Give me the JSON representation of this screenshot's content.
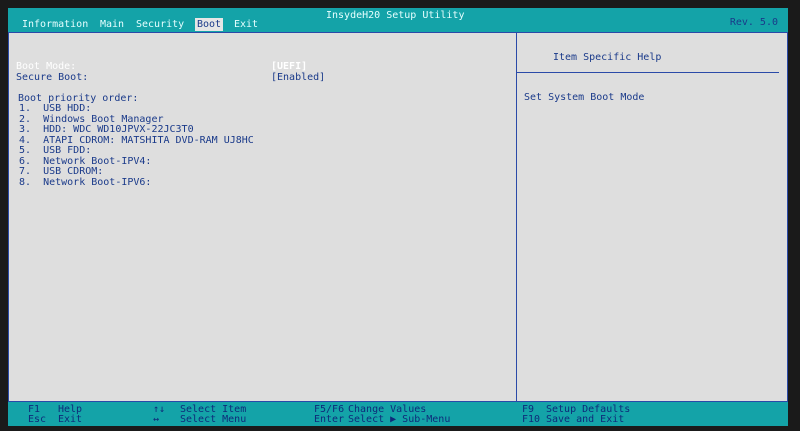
{
  "app_title": "InsydeH20 Setup Utility",
  "revision": "Rev. 5.0",
  "menu": [
    "Information",
    "Main",
    "Security",
    "Boot",
    "Exit"
  ],
  "boot_mode": {
    "label": "Boot Mode:",
    "value": "[UEFI]"
  },
  "secure_boot": {
    "label": "Secure Boot:",
    "value": "[Enabled]"
  },
  "boot_priority": {
    "heading": "Boot priority order:",
    "items": [
      "1.  USB HDD:",
      "2.  Windows Boot Manager",
      "3.  HDD: WDC WD10JPVX-22JC3T0",
      "4.  ATAPI CDROM: MATSHITA DVD-RAM UJ8HC",
      "5.  USB FDD:",
      "6.  Network Boot-IPV4:",
      "7.  USB CDROM:",
      "8.  Network Boot-IPV6:"
    ]
  },
  "help": {
    "title": "Item Specific Help",
    "text": "Set System Boot Mode"
  },
  "footer": {
    "f1_key": "F1",
    "f1_desc": "Help",
    "esc_key": "Esc",
    "esc_desc": "Exit",
    "arrows_ud_key": "↑↓",
    "arrows_ud_desc": "Select Item",
    "arrows_lr_key": "↔",
    "arrows_lr_desc": "Select Menu",
    "f5f6_key": "F5/F6",
    "f5f6_desc": "Change Values",
    "enter_key": "Enter",
    "enter_desc": "Select ▶ Sub-Menu",
    "f9_key": "F9",
    "f9_desc": "Setup Defaults",
    "f10_key": "F10",
    "f10_desc": "Save and Exit"
  },
  "colors": {
    "teal": "#14a3a8",
    "blue": "#1a3a8a",
    "panel": "#dedede"
  }
}
